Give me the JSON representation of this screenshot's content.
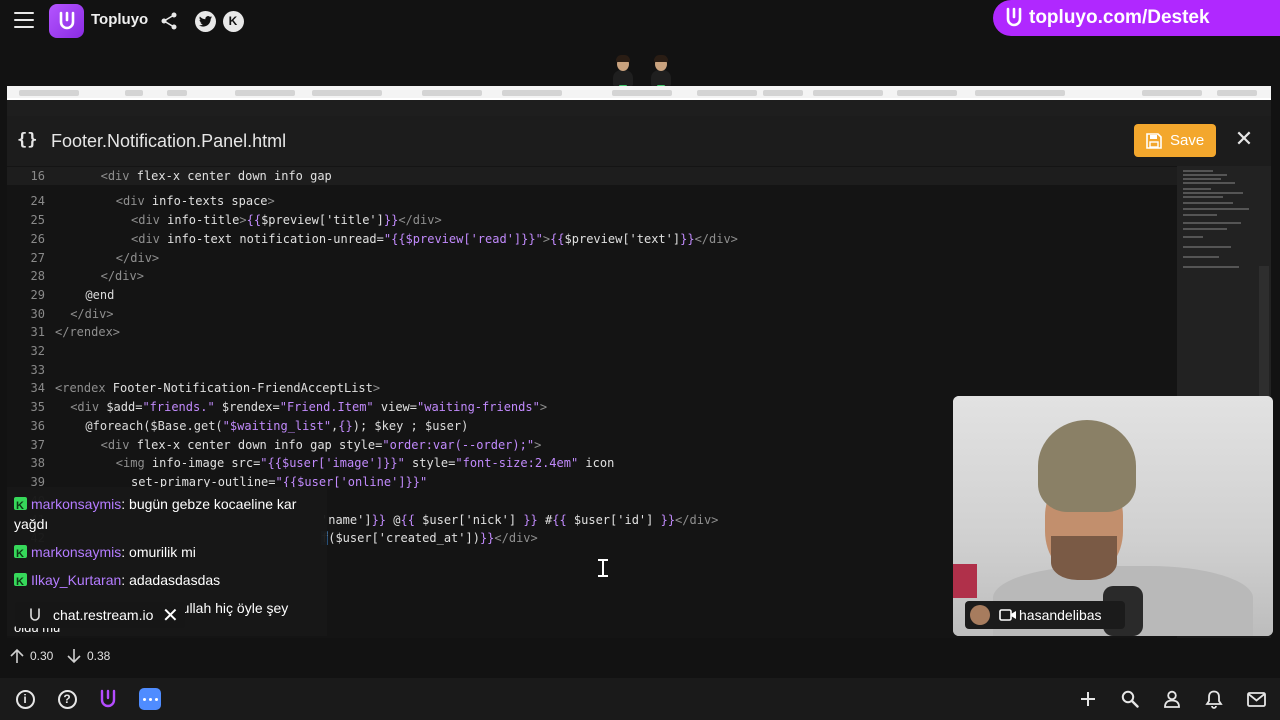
{
  "topbar": {
    "title": "Topluyo",
    "icons": [
      "menu-icon",
      "topluyo-logo-icon",
      "share-icon",
      "twitter-icon",
      "kick-icon"
    ],
    "kick_letter": "K"
  },
  "banner": {
    "text": "topluyo.com/Destek"
  },
  "editor": {
    "file_icon": "{}",
    "file_name": "Footer.Notification.Panel.html",
    "save_label": "Save",
    "close_label": "✕",
    "accent": "#f3a72d"
  },
  "code_lines": [
    {
      "n": "16",
      "hl": true,
      "indent": 6,
      "segs": [
        [
          "tag",
          "<div "
        ],
        [
          "attr",
          "flex-x center down info gap"
        ]
      ]
    },
    {
      "n": "24",
      "indent": 8,
      "segs": [
        [
          "tag",
          "<div "
        ],
        [
          "attr",
          "info-texts space"
        ],
        [
          "tag",
          ">"
        ]
      ]
    },
    {
      "n": "25",
      "indent": 10,
      "segs": [
        [
          "tag",
          "<div "
        ],
        [
          "attr",
          "info-title"
        ],
        [
          "tag",
          ">"
        ],
        [
          "brace",
          "{{"
        ],
        [
          "var",
          "$preview['title']"
        ],
        [
          "brace",
          "}}"
        ],
        [
          "tag",
          "</div>"
        ]
      ]
    },
    {
      "n": "26",
      "indent": 10,
      "segs": [
        [
          "tag",
          "<div "
        ],
        [
          "attr",
          "info-text notification-unread="
        ],
        [
          "str",
          "\"{{$preview['read']}}\""
        ],
        [
          "tag",
          ">"
        ],
        [
          "brace",
          "{{"
        ],
        [
          "var",
          "$preview['text']"
        ],
        [
          "brace",
          "}}"
        ],
        [
          "tag",
          "</div>"
        ]
      ]
    },
    {
      "n": "27",
      "indent": 8,
      "segs": [
        [
          "tag",
          "</div>"
        ]
      ]
    },
    {
      "n": "28",
      "indent": 6,
      "segs": [
        [
          "tag",
          "</div>"
        ]
      ]
    },
    {
      "n": "29",
      "indent": 4,
      "segs": [
        [
          "at",
          "@end"
        ]
      ]
    },
    {
      "n": "30",
      "indent": 2,
      "segs": [
        [
          "tag",
          "</div>"
        ]
      ]
    },
    {
      "n": "31",
      "indent": 0,
      "segs": [
        [
          "tag",
          "</rendex>"
        ]
      ]
    },
    {
      "n": "32",
      "indent": 0,
      "segs": []
    },
    {
      "n": "33",
      "indent": 0,
      "segs": []
    },
    {
      "n": "34",
      "indent": 0,
      "segs": [
        [
          "tag",
          "<rendex "
        ],
        [
          "attr",
          "Footer-Notification-FriendAcceptList"
        ],
        [
          "tag",
          ">"
        ]
      ]
    },
    {
      "n": "35",
      "indent": 2,
      "segs": [
        [
          "tag",
          "<div "
        ],
        [
          "attr",
          "$add="
        ],
        [
          "str",
          "\"friends.\""
        ],
        [
          "attr",
          " $rendex="
        ],
        [
          "str",
          "\"Friend.Item\""
        ],
        [
          "attr",
          " view="
        ],
        [
          "str",
          "\"waiting-friends\""
        ],
        [
          "tag",
          ">"
        ]
      ]
    },
    {
      "n": "36",
      "indent": 4,
      "segs": [
        [
          "at",
          "@foreach($Base.get("
        ],
        [
          "str",
          "\"$waiting_list\""
        ],
        [
          "at",
          ","
        ],
        [
          "brace",
          "{}"
        ],
        [
          "at",
          "); $key ; $user)"
        ]
      ]
    },
    {
      "n": "37",
      "indent": 6,
      "segs": [
        [
          "tag",
          "<div "
        ],
        [
          "attr",
          "flex-x center down info gap style="
        ],
        [
          "str",
          "\"order:var(--order);\""
        ],
        [
          "tag",
          ">"
        ]
      ]
    },
    {
      "n": "38",
      "indent": 8,
      "segs": [
        [
          "tag",
          "<img "
        ],
        [
          "attr",
          "info-image src="
        ],
        [
          "str",
          "\"{{$user['image']}}\""
        ],
        [
          "attr",
          " style="
        ],
        [
          "str",
          "\"font-size:2.4em\""
        ],
        [
          "attr",
          " icon"
        ]
      ]
    },
    {
      "n": "39",
      "indent": 10,
      "segs": [
        [
          "attr",
          "set-primary-outline="
        ],
        [
          "str",
          "\"{{$user['online']}}\""
        ]
      ]
    },
    {
      "n": "40",
      "indent": 0,
      "segs": []
    },
    {
      "n": "41",
      "indent": 35,
      "segs": [
        [
          "attr",
          "'name']"
        ],
        [
          "brace",
          "}}"
        ],
        [
          "attr",
          " @"
        ],
        [
          "brace",
          "{{"
        ],
        [
          "attr",
          " $user['nick'] "
        ],
        [
          "brace",
          "}}"
        ],
        [
          "attr",
          " #"
        ],
        [
          "brace",
          "{{"
        ],
        [
          "attr",
          " $user['id'] "
        ],
        [
          "brace",
          "}}"
        ],
        [
          "tag",
          "</div>"
        ]
      ]
    },
    {
      "n": "42",
      "indent": 35,
      "segs": [
        [
          "sel",
          "f"
        ],
        [
          "attr",
          "($user['created_at'])"
        ],
        [
          "brace",
          "}}"
        ],
        [
          "tag",
          "</div>"
        ]
      ]
    }
  ],
  "chat": {
    "messages": [
      {
        "user": "markonsaymis",
        "text": "bugün gebze kocaeline kar yağdı"
      },
      {
        "user": "markonsaymis",
        "text": "omurilik mi"
      },
      {
        "user": "Ilkay_Kurtaran",
        "text": "adadasdasdas"
      },
      {
        "user": "",
        "text": "firullah hiç öyle şey"
      },
      {
        "user": "",
        "text": "oldu mu"
      }
    ],
    "source_label": "chat.restream.io",
    "close_label": "✕"
  },
  "webcam": {
    "name": "hasandelibas"
  },
  "stats": {
    "up": "0.30",
    "down": "0.38"
  },
  "bottombar": {
    "left_icons": [
      "info-icon",
      "help-icon",
      "topluyo-icon",
      "chat-icon"
    ],
    "right_icons": [
      "plus-icon",
      "search-icon",
      "user-icon",
      "bell-icon",
      "mail-icon"
    ],
    "info_glyph": "i",
    "help_glyph": "?"
  }
}
